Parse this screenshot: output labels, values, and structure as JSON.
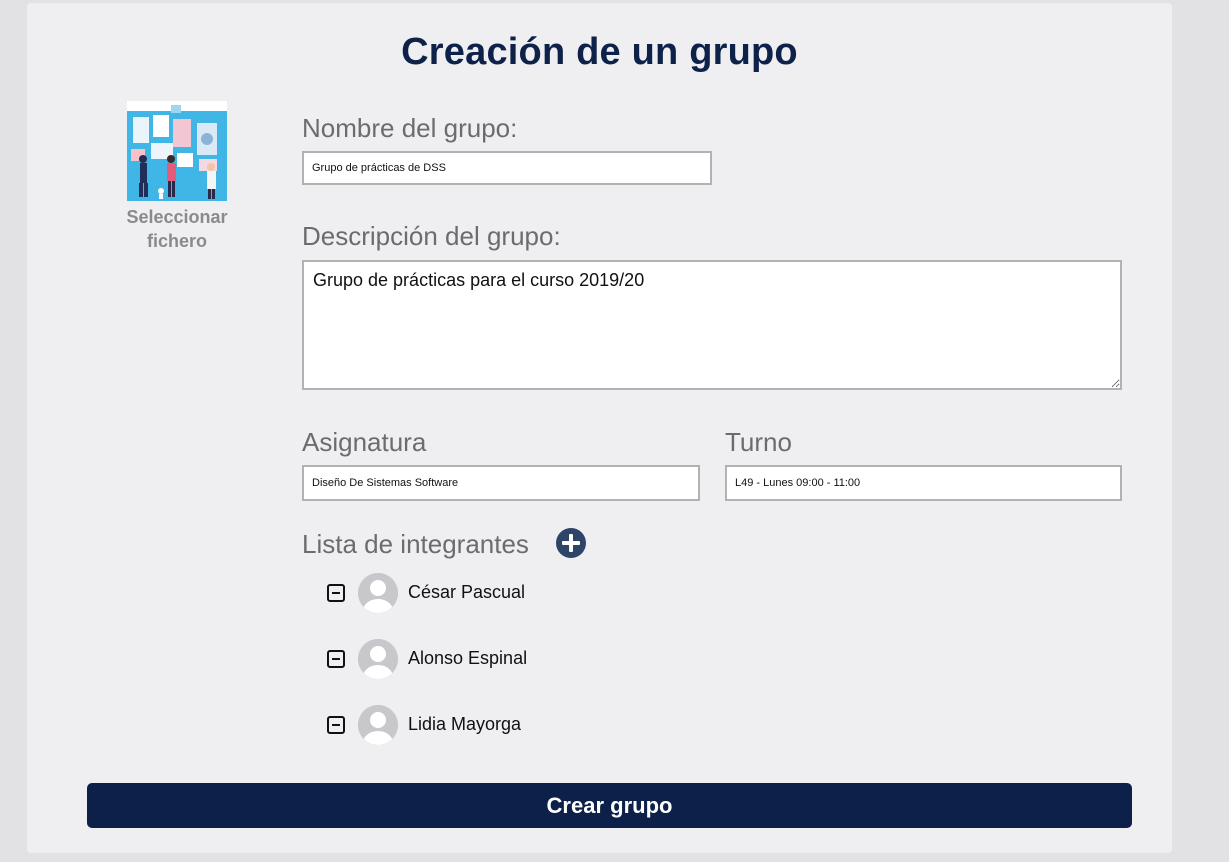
{
  "page": {
    "title": "Creación de un grupo"
  },
  "image_picker": {
    "label": "Seleccionar fichero",
    "icon": "group-illustration-icon"
  },
  "form": {
    "name": {
      "label": "Nombre del grupo:",
      "value": "Grupo de prácticas de DSS"
    },
    "description": {
      "label": "Descripción del grupo:",
      "value": "Grupo de prácticas para el curso 2019/20"
    },
    "subject": {
      "label": "Asignatura",
      "value": "Diseño De Sistemas Software"
    },
    "shift": {
      "label": "Turno",
      "value": "L49 - Lunes 09:00 - 11:00"
    }
  },
  "members": {
    "label": "Lista de integrantes",
    "add_icon": "plus-circle-icon",
    "remove_icon": "minus-square-icon",
    "items": [
      {
        "name": "César Pascual"
      },
      {
        "name": "Alonso Espinal"
      },
      {
        "name": "Lidia Mayorga"
      }
    ]
  },
  "submit": {
    "label": "Crear grupo"
  },
  "colors": {
    "title": "#0d2149",
    "label": "#6c6c70",
    "submit_bg": "#0c2049",
    "add_icon": "#2e4468",
    "card_bg": "#efeff2",
    "page_bg": "#e2e2e5"
  }
}
